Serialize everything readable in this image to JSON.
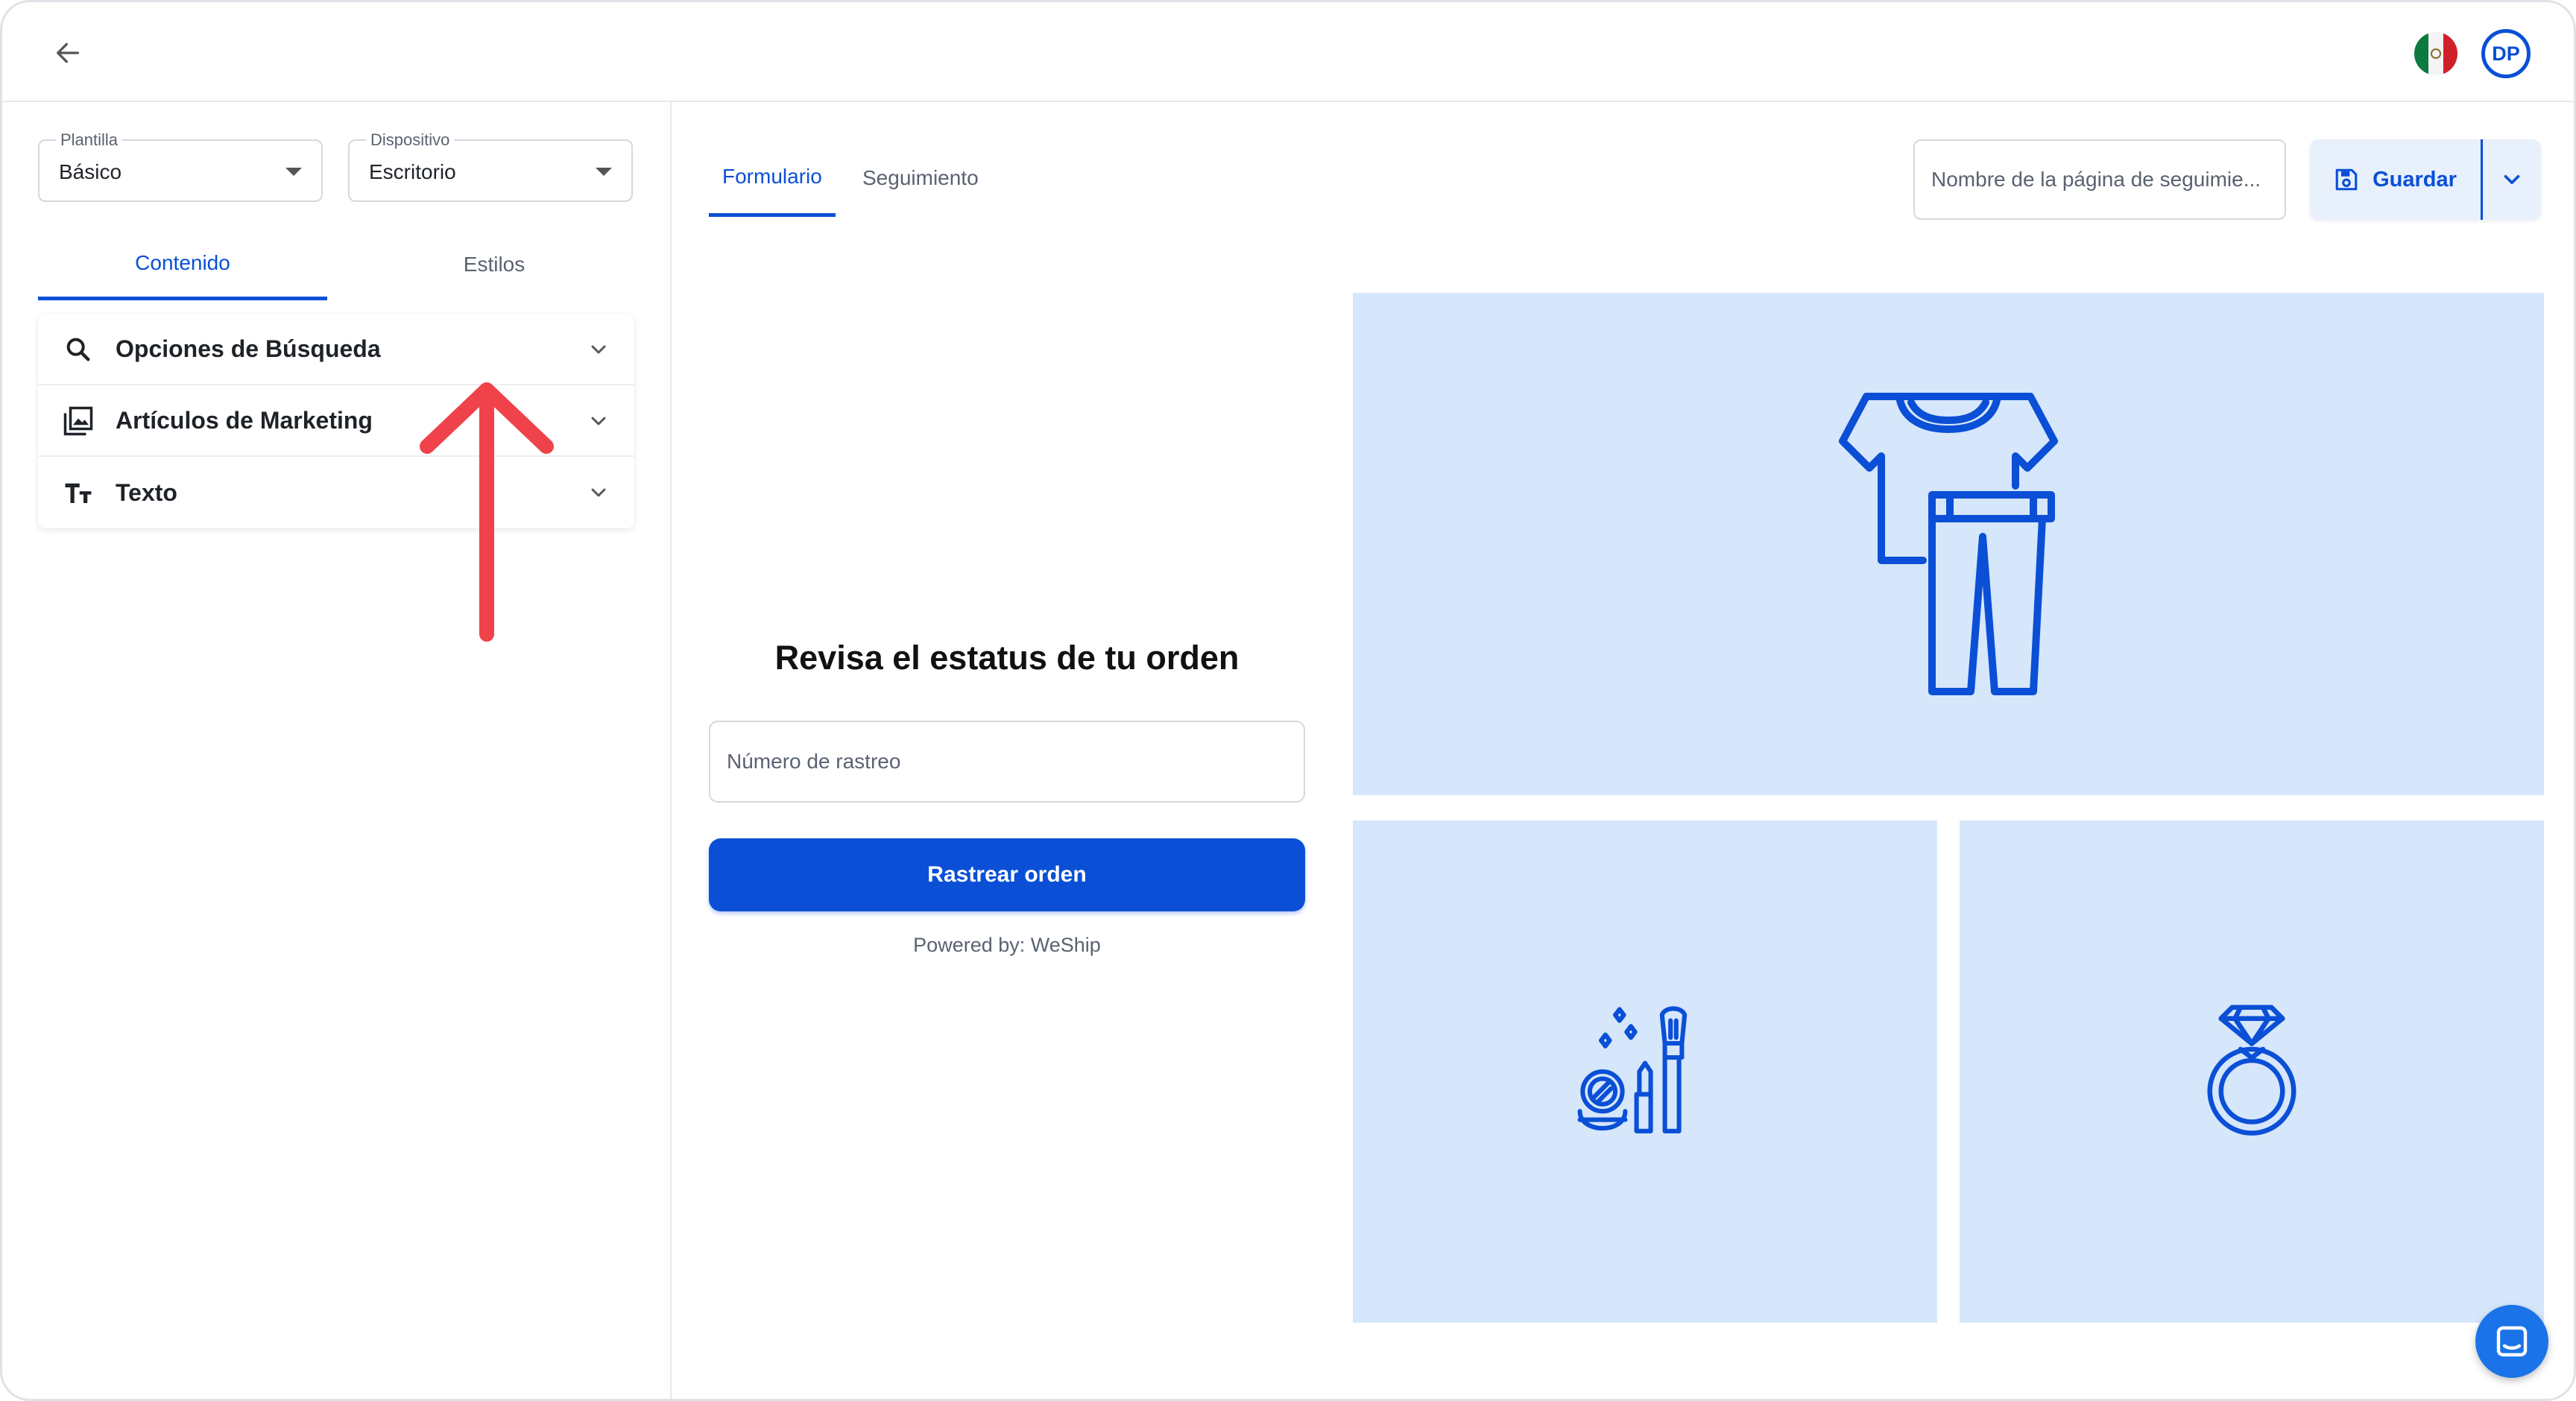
{
  "topbar": {
    "back_icon": "arrow-left-icon",
    "flag_icon": "mexico-flag-icon",
    "avatar_initials": "DP"
  },
  "sidebar": {
    "template_select": {
      "legend": "Plantilla",
      "value": "Básico"
    },
    "device_select": {
      "legend": "Dispositivo",
      "value": "Escritorio"
    },
    "tabs": [
      {
        "label": "Contenido",
        "active": true
      },
      {
        "label": "Estilos",
        "active": false
      }
    ],
    "sections": [
      {
        "label": "Opciones de Búsqueda",
        "icon": "search-icon"
      },
      {
        "label": "Artículos de Marketing",
        "icon": "image-gallery-icon"
      },
      {
        "label": "Texto",
        "icon": "text-size-icon"
      }
    ]
  },
  "main": {
    "tabs": [
      {
        "label": "Formulario",
        "active": true
      },
      {
        "label": "Seguimiento",
        "active": false
      }
    ],
    "page_name_placeholder": "Nombre de la página de seguimie...",
    "save_label": "Guardar",
    "form": {
      "title": "Revisa el estatus de tu orden",
      "tracking_placeholder": "Número de rastreo",
      "button_label": "Rastrear orden",
      "powered_by": "Powered by: WeShip"
    },
    "marketing_tiles": [
      {
        "icon": "clothing-icon"
      },
      {
        "icon": "makeup-icon"
      },
      {
        "icon": "ring-icon"
      }
    ]
  },
  "chat_icon": "chat-icon",
  "colors": {
    "accent": "#0a4fd6",
    "tile_bg": "#d6e6fb",
    "annotation_arrow": "#f0424a"
  }
}
